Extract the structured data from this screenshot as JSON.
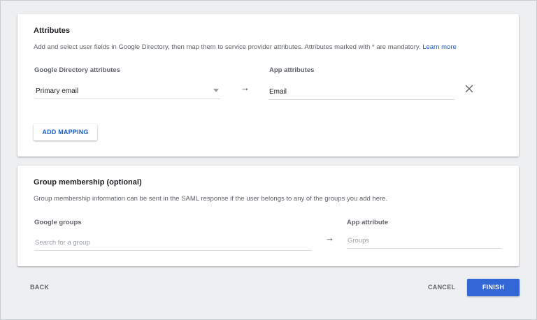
{
  "attributes": {
    "title": "Attributes",
    "description": "Add and select user fields in Google Directory, then map them to service provider attributes. Attributes marked with * are mandatory.",
    "learn_more": "Learn more",
    "google_directory_label": "Google Directory attributes",
    "app_attributes_label": "App attributes",
    "mapping": {
      "directory_value": "Primary email",
      "app_value": "Email"
    },
    "add_mapping_label": "ADD MAPPING"
  },
  "group_membership": {
    "title": "Group membership (optional)",
    "description": "Group membership information can be sent in the SAML response if the user belongs to any of the groups you add here.",
    "google_groups_label": "Google groups",
    "search_placeholder": "Search for a group",
    "app_attribute_label": "App attribute",
    "app_attribute_placeholder": "Groups"
  },
  "footer": {
    "back_label": "BACK",
    "cancel_label": "CANCEL",
    "finish_label": "FINISH"
  },
  "icons": {
    "arrow": "arrow-right-icon",
    "close": "close-icon",
    "dropdown": "dropdown-caret-icon"
  },
  "colors": {
    "primary": "#3367d6",
    "link": "#1a5dc9",
    "background": "#eeeff1"
  }
}
